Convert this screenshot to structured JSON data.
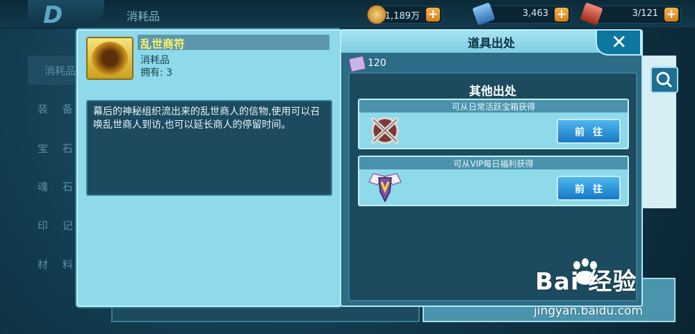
{
  "topbar": {
    "category_title": "消耗品",
    "resources": [
      {
        "name": "gold-coin",
        "value": "1,189万",
        "color": "#d99a2b"
      },
      {
        "name": "diamond",
        "value": "3,463",
        "color": "#4c8fd0"
      },
      {
        "name": "stamina",
        "value": "3/121",
        "color": "#c74b3a"
      }
    ]
  },
  "sidebar": {
    "items": [
      {
        "label": "消耗品"
      },
      {
        "label": "装 备"
      },
      {
        "label": "宝 石"
      },
      {
        "label": "魂 石"
      },
      {
        "label": "印 记"
      },
      {
        "label": "材 料"
      }
    ]
  },
  "item": {
    "name": "乱世商符",
    "type": "消耗品",
    "owned_label": "拥有:",
    "owned_count": "3",
    "description": "幕后的神秘组织流出来的乱世商人的信物,使用可以召唤乱世商人到访,也可以延长商人的停留时间。"
  },
  "source_panel": {
    "title": "道具出处",
    "cost": "120",
    "section_title": "其他出处",
    "sources": [
      {
        "text": "可从日常活跃宝箱获得",
        "button": "前往",
        "icon": "crossed-swords-shield-icon"
      },
      {
        "text": "可从VIP每日福利获得",
        "button": "前往",
        "icon": "winged-vip-badge-icon"
      }
    ]
  },
  "watermark": {
    "brand": "Bai  经验",
    "url": "jingyan.baidu.com"
  }
}
